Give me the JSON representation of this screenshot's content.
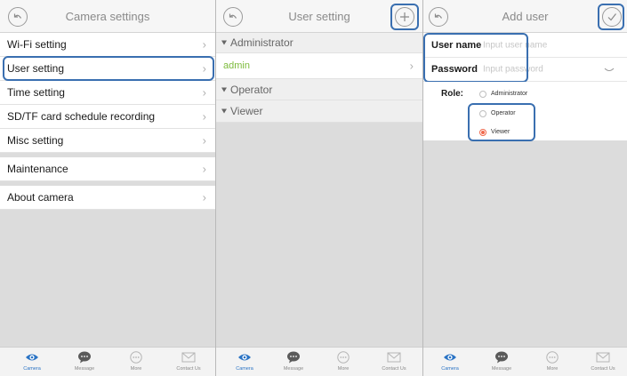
{
  "panel1": {
    "title": "Camera settings",
    "items": [
      {
        "label": "Wi-Fi setting"
      },
      {
        "label": "User setting"
      },
      {
        "label": "Time setting"
      },
      {
        "label": "SD/TF card schedule recording"
      },
      {
        "label": "Misc setting"
      },
      {
        "label": "Maintenance"
      },
      {
        "label": "About camera"
      }
    ],
    "chevron": "›"
  },
  "panel2": {
    "title": "User setting",
    "sections": [
      {
        "label": "Administrator"
      },
      {
        "label": "Operator"
      },
      {
        "label": "Viewer"
      }
    ],
    "users": [
      {
        "name": "admin",
        "color": "#7dbb3c"
      }
    ],
    "chevron": "›"
  },
  "panel3": {
    "title": "Add user",
    "username_label": "User name",
    "username_placeholder": "Input user name",
    "password_label": "Password",
    "password_placeholder": "Input password",
    "role_label": "Role:",
    "roles": [
      {
        "label": "Administrator",
        "selected": false
      },
      {
        "label": "Operator",
        "selected": false
      },
      {
        "label": "Viewer",
        "selected": true
      }
    ]
  },
  "tabs": [
    {
      "label": "Camera",
      "icon": "eye-icon",
      "active": true
    },
    {
      "label": "Message",
      "icon": "chat-bubble-icon",
      "active": false
    },
    {
      "label": "More",
      "icon": "more-dots-icon",
      "active": false
    },
    {
      "label": "Contact Us",
      "icon": "envelope-icon",
      "active": false
    }
  ],
  "colors": {
    "accent": "#2a73c4",
    "highlight": "#3a6fb0",
    "radio_selected": "#f0694c",
    "admin_text": "#7dbb3c"
  }
}
